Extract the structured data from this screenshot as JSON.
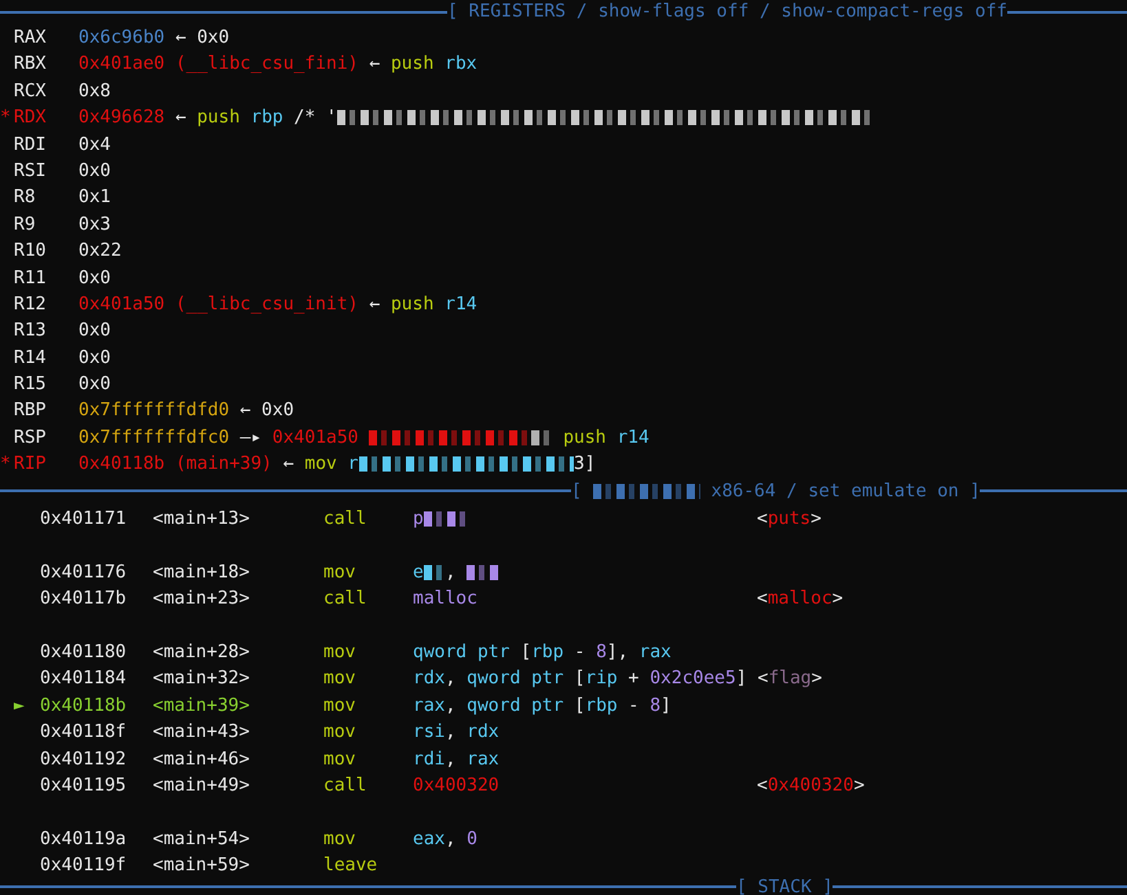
{
  "headers": [
    {
      "title": [
        {
          "text": "[ REGISTERS / show-flags off / show-compact-regs off",
          "color": "#3d6fb0"
        }
      ]
    },
    {
      "title": [
        {
          "text": "[ ",
          "color": "#3d6fb0"
        },
        {
          "kind": "redacted",
          "color": "#3d6fb0"
        },
        {
          "text": " x86-64 / set emulate on ]",
          "color": "#3d6fb0"
        }
      ]
    },
    {
      "title": [
        {
          "text": "[ STACK ]",
          "color": "#3d6fb0"
        }
      ]
    }
  ],
  "registers": [
    {
      "name": "RAX",
      "changed": false,
      "value": [
        {
          "text": "0x6c96b0",
          "color": "#4a84c8"
        },
        {
          "text": " ← 0x0",
          "color": "#e6e6e6"
        }
      ]
    },
    {
      "name": "RBX",
      "changed": false,
      "value": [
        {
          "text": "0x401ae0 (__libc_csu_fini)",
          "color": "#e01010"
        },
        {
          "text": " ← ",
          "color": "#e6e6e6"
        },
        {
          "text": "push",
          "color": "#b8cc10"
        },
        {
          "text": " rbx",
          "color": "#58c8f0"
        }
      ]
    },
    {
      "name": "RCX",
      "changed": false,
      "value": [
        {
          "text": "0x8",
          "color": "#e6e6e6"
        }
      ]
    },
    {
      "name": "RDX",
      "changed": true,
      "marker": "*",
      "value": [
        {
          "text": "0x496628",
          "color": "#e01010"
        },
        {
          "text": " ← ",
          "color": "#e6e6e6"
        },
        {
          "text": "push",
          "color": "#b8cc10"
        },
        {
          "text": " rbp",
          "color": "#58c8f0"
        },
        {
          "text": " /* '",
          "color": "#e6e6e6"
        },
        {
          "kind": "redacted",
          "color": "#c8c8c8"
        }
      ]
    },
    {
      "name": "RDI",
      "changed": false,
      "value": [
        {
          "text": "0x4",
          "color": "#e6e6e6"
        }
      ]
    },
    {
      "name": "RSI",
      "changed": false,
      "value": [
        {
          "text": "0x0",
          "color": "#e6e6e6"
        }
      ]
    },
    {
      "name": "R8",
      "changed": false,
      "value": [
        {
          "text": "0x1",
          "color": "#e6e6e6"
        }
      ]
    },
    {
      "name": "R9",
      "changed": false,
      "value": [
        {
          "text": "0x3",
          "color": "#e6e6e6"
        }
      ]
    },
    {
      "name": "R10",
      "changed": false,
      "value": [
        {
          "text": "0x22",
          "color": "#e6e6e6"
        }
      ]
    },
    {
      "name": "R11",
      "changed": false,
      "value": [
        {
          "text": "0x0",
          "color": "#e6e6e6"
        }
      ]
    },
    {
      "name": "R12",
      "changed": false,
      "value": [
        {
          "text": "0x401a50 (__libc_csu_init)",
          "color": "#e01010"
        },
        {
          "text": " ← ",
          "color": "#e6e6e6"
        },
        {
          "text": "push",
          "color": "#b8cc10"
        },
        {
          "text": " r14",
          "color": "#58c8f0"
        }
      ]
    },
    {
      "name": "R13",
      "changed": false,
      "value": [
        {
          "text": "0x0",
          "color": "#e6e6e6"
        }
      ]
    },
    {
      "name": "R14",
      "changed": false,
      "value": [
        {
          "text": "0x0",
          "color": "#e6e6e6"
        }
      ]
    },
    {
      "name": "R15",
      "changed": false,
      "value": [
        {
          "text": "0x0",
          "color": "#e6e6e6"
        }
      ]
    },
    {
      "name": "RBP",
      "changed": false,
      "value": [
        {
          "text": "0x7fffffffdfd0",
          "color": "#d4a410"
        },
        {
          "text": " ← 0x0",
          "color": "#e6e6e6"
        }
      ]
    },
    {
      "name": "RSP",
      "changed": false,
      "value": [
        {
          "text": "0x7fffffffdfc0",
          "color": "#d4a410"
        },
        {
          "text": " —▸ ",
          "color": "#e6e6e6"
        },
        {
          "text": "0x401a50 ",
          "color": "#e01010"
        },
        {
          "kind": "redacted",
          "color": "#e01010"
        },
        {
          "kind": "redacted",
          "color": "#b0b0b0"
        },
        {
          "text": " push",
          "color": "#b8cc10"
        },
        {
          "text": " r14",
          "color": "#58c8f0"
        }
      ]
    },
    {
      "name": "RIP",
      "changed": true,
      "marker": "*",
      "value": [
        {
          "text": "0x40118b (main+39)",
          "color": "#e01010"
        },
        {
          "text": " ← ",
          "color": "#e6e6e6"
        },
        {
          "text": "mov",
          "color": "#b8cc10"
        },
        {
          "text": " r",
          "color": "#58c8f0"
        },
        {
          "kind": "redacted",
          "color": "#58c8f0"
        },
        {
          "text": "3]",
          "color": "#e6e6e6"
        }
      ]
    }
  ],
  "disassembly": [
    [
      {
        "current": false,
        "address": "0x401171",
        "symbol": "<main+13>",
        "mnemonic": "call",
        "operands": [
          {
            "text": "p",
            "color": "#a888e8"
          },
          {
            "kind": "redacted",
            "color": "#a888e8"
          }
        ],
        "comment": [
          {
            "text": "<",
            "color": "#e6e6e6"
          },
          {
            "text": "puts",
            "color": "#e01010"
          },
          {
            "text": ">",
            "color": "#e6e6e6"
          }
        ]
      }
    ],
    [
      {
        "current": false,
        "address": "0x401176",
        "symbol": "<main+18>",
        "mnemonic": "mov",
        "operands": [
          {
            "text": "e",
            "color": "#58c8f0"
          },
          {
            "kind": "redacted",
            "color": "#58c8f0"
          },
          {
            "text": ", ",
            "color": "#e6e6e6"
          },
          {
            "kind": "redacted",
            "color": "#a888e8"
          }
        ]
      },
      {
        "current": false,
        "address": "0x40117b",
        "symbol": "<main+23>",
        "mnemonic": "call",
        "operands": [
          {
            "text": "malloc",
            "color": "#a888e8"
          }
        ],
        "comment": [
          {
            "text": "<",
            "color": "#e6e6e6"
          },
          {
            "text": "malloc",
            "color": "#e01010"
          },
          {
            "text": ">",
            "color": "#e6e6e6"
          }
        ]
      }
    ],
    [
      {
        "current": false,
        "address": "0x401180",
        "symbol": "<main+28>",
        "mnemonic": "mov",
        "operands": [
          {
            "text": "qword ptr ",
            "color": "#58c8f0"
          },
          {
            "text": "[",
            "color": "#e6e6e6"
          },
          {
            "text": "rbp",
            "color": "#58c8f0"
          },
          {
            "text": " - ",
            "color": "#e6e6e6"
          },
          {
            "text": "8",
            "color": "#a888e8"
          },
          {
            "text": "], ",
            "color": "#e6e6e6"
          },
          {
            "text": "rax",
            "color": "#58c8f0"
          }
        ]
      },
      {
        "current": false,
        "address": "0x401184",
        "symbol": "<main+32>",
        "mnemonic": "mov",
        "operands": [
          {
            "text": "rdx",
            "color": "#58c8f0"
          },
          {
            "text": ", ",
            "color": "#e6e6e6"
          },
          {
            "text": "qword ptr ",
            "color": "#58c8f0"
          },
          {
            "text": "[",
            "color": "#e6e6e6"
          },
          {
            "text": "rip",
            "color": "#58c8f0"
          },
          {
            "text": " + ",
            "color": "#e6e6e6"
          },
          {
            "text": "0x2c0ee5",
            "color": "#a888e8"
          },
          {
            "text": "] ",
            "color": "#e6e6e6"
          },
          {
            "text": "<",
            "color": "#e6e6e6"
          },
          {
            "text": "flag",
            "color": "#8a6a8c"
          },
          {
            "text": ">",
            "color": "#e6e6e6"
          }
        ]
      },
      {
        "current": true,
        "marker": "►",
        "address": "0x40118b",
        "symbol": "<main+39>",
        "mnemonic": "mov",
        "operands": [
          {
            "text": "rax",
            "color": "#58c8f0"
          },
          {
            "text": ", ",
            "color": "#e6e6e6"
          },
          {
            "text": "qword ptr ",
            "color": "#58c8f0"
          },
          {
            "text": "[",
            "color": "#e6e6e6"
          },
          {
            "text": "rbp",
            "color": "#58c8f0"
          },
          {
            "text": " - ",
            "color": "#e6e6e6"
          },
          {
            "text": "8",
            "color": "#a888e8"
          },
          {
            "text": "]",
            "color": "#e6e6e6"
          }
        ]
      },
      {
        "current": false,
        "address": "0x40118f",
        "symbol": "<main+43>",
        "mnemonic": "mov",
        "operands": [
          {
            "text": "rsi",
            "color": "#58c8f0"
          },
          {
            "text": ", ",
            "color": "#e6e6e6"
          },
          {
            "text": "rdx",
            "color": "#58c8f0"
          }
        ]
      },
      {
        "current": false,
        "address": "0x401192",
        "symbol": "<main+46>",
        "mnemonic": "mov",
        "operands": [
          {
            "text": "rdi",
            "color": "#58c8f0"
          },
          {
            "text": ", ",
            "color": "#e6e6e6"
          },
          {
            "text": "rax",
            "color": "#58c8f0"
          }
        ]
      },
      {
        "current": false,
        "address": "0x401195",
        "symbol": "<main+49>",
        "mnemonic": "call",
        "operands": [
          {
            "text": "0x400320",
            "color": "#e01010"
          }
        ],
        "comment": [
          {
            "text": "<",
            "color": "#e6e6e6"
          },
          {
            "text": "0x400320",
            "color": "#e01010"
          },
          {
            "text": ">",
            "color": "#e6e6e6"
          }
        ]
      }
    ],
    [
      {
        "current": false,
        "address": "0x40119a",
        "symbol": "<main+54>",
        "mnemonic": "mov",
        "operands": [
          {
            "text": "eax",
            "color": "#58c8f0"
          },
          {
            "text": ", ",
            "color": "#e6e6e6"
          },
          {
            "text": "0",
            "color": "#a888e8"
          }
        ]
      },
      {
        "current": false,
        "address": "0x40119f",
        "symbol": "<main+59>",
        "mnemonic": "leave"
      }
    ]
  ]
}
